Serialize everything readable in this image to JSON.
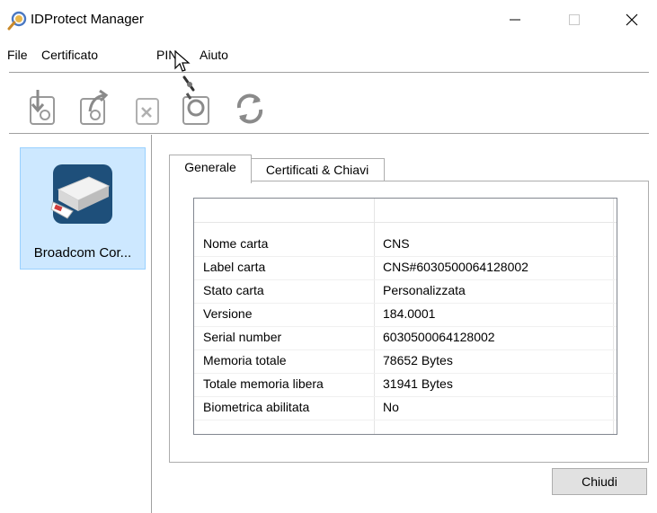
{
  "window": {
    "title": "IDProtect Manager",
    "minimize_glyph": "—",
    "maximize_glyph": "☐",
    "close_glyph": "✕"
  },
  "menu": {
    "items": [
      "File",
      "Certificato",
      "PIN",
      "Aiuto"
    ]
  },
  "toolbar": {
    "buttons": [
      "import-certificate-icon",
      "export-certificate-icon",
      "delete-certificate-icon",
      "view-certificate-icon",
      "refresh-icon"
    ]
  },
  "devices": [
    {
      "label": "Broadcom Cor...",
      "icon": "card-reader-icon",
      "selected": true
    }
  ],
  "tabs": [
    {
      "label": "Generale",
      "active": true
    },
    {
      "label": "Certificati & Chiavi",
      "active": false
    }
  ],
  "properties": [
    {
      "name": "Nome carta",
      "value": "CNS"
    },
    {
      "name": "Label carta",
      "value": "CNS#6030500064128002"
    },
    {
      "name": "Stato carta",
      "value": "Personalizzata"
    },
    {
      "name": "Versione",
      "value": "184.0001"
    },
    {
      "name": "Serial number",
      "value": "6030500064128002"
    },
    {
      "name": "Memoria totale",
      "value": "78652 Bytes"
    },
    {
      "name": "Totale memoria libera",
      "value": "31941 Bytes"
    },
    {
      "name": "Biometrica abilitata",
      "value": "No"
    }
  ],
  "buttons": {
    "close_label": "Chiudi"
  },
  "colors": {
    "selection_bg": "#cde8ff",
    "selection_border": "#99d1ff",
    "button_bg": "#e1e1e1"
  }
}
